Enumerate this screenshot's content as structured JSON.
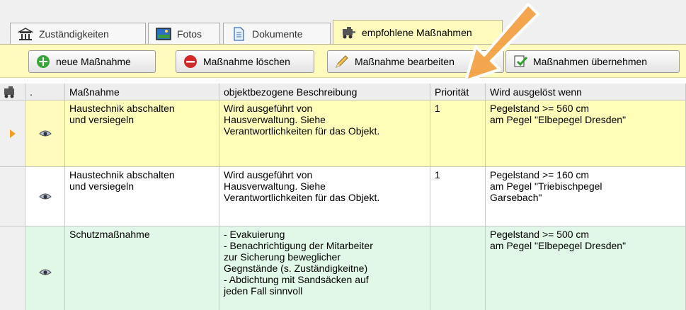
{
  "tabs": [
    {
      "label": "Zuständigkeiten",
      "icon": "building-icon"
    },
    {
      "label": "Fotos",
      "icon": "photo-icon"
    },
    {
      "label": "Dokumente",
      "icon": "document-icon"
    },
    {
      "label": "empfohlene Maßnahmen",
      "icon": "equipment-icon",
      "active": true
    }
  ],
  "toolbar": {
    "new_label": "neue Maßnahme",
    "delete_label": "Maßnahme löschen",
    "edit_label": "Maßnahme bearbeiten",
    "adopt_label": "Maßnahmen übernehmen"
  },
  "grid": {
    "columns": [
      ".",
      "Maßnahme",
      "objektbezogene Beschreibung",
      "Priorität",
      "Wird ausgelöst wenn"
    ],
    "rows": [
      {
        "selected": true,
        "color": "#ffffb9",
        "measure": "Haustechnik abschalten\nund versiegeln",
        "description": "Wird ausgeführt von\nHausverwaltung. Siehe\nVerantwortlichkeiten für das Objekt.",
        "priority": "1",
        "trigger": "Pegelstand >= 560 cm\nam Pegel \"Elbepegel Dresden\""
      },
      {
        "selected": false,
        "color": "#ffffff",
        "measure": "Haustechnik abschalten\nund versiegeln",
        "description": "Wird ausgeführt von\nHausverwaltung. Siehe\nVerantwortlichkeiten für das Objekt.",
        "priority": "1",
        "trigger": "Pegelstand >= 160 cm\nam Pegel \"Triebischpegel\nGarsebach\""
      },
      {
        "selected": false,
        "color": "#e2f8e6",
        "measure": "Schutzmaßnahme",
        "description": "- Evakuierung\n- Benachrichtigung der Mitarbeiter\nzur Sicherung beweglicher\nGegnstände (s. Zuständigkeitne)\n- Abdichtung mit Sandsäcken auf\njeden Fall sinnvoll",
        "priority": "",
        "trigger": "Pegelstand >= 500 cm\nam Pegel \"Elbepegel Dresden\""
      }
    ]
  },
  "colors": {
    "accent_yellow": "#fffbbd",
    "arrow_orange": "#f4a040",
    "new_icon_green": "#3aa53a",
    "delete_icon_red": "#d22a2a"
  }
}
